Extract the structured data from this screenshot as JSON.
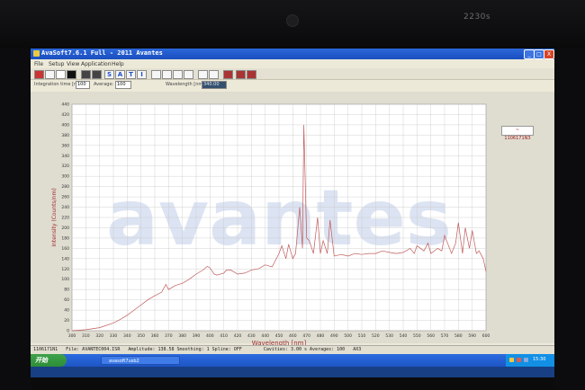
{
  "monitor": {
    "brand": "2230s"
  },
  "window": {
    "title": "AvaSoft7.6.1 Full - 2011 Avantes",
    "min_label": "_",
    "max_label": "□",
    "close_label": "X"
  },
  "menu": [
    "File",
    "Setup",
    "View",
    "Application",
    "Help"
  ],
  "toolbar": {
    "tool_s": "S",
    "tool_a": "A",
    "tool_t": "T",
    "tool_i": "I"
  },
  "params": {
    "integration_label": "Integration time [ms]:",
    "integration_value": "100",
    "average_label": "Average:",
    "average_value": "100",
    "wavelength_label": "Wavelength [nm]:",
    "wavelength_value": "340.00"
  },
  "legend": {
    "label": "~ 1106171N3"
  },
  "status": {
    "text": "1106171N1   File: AVANTEC004.ISR   Amplitude: 138.58 Smoothing: 1 Spline: OFF        Cavities: 3.00 s Averages: 100   AX3"
  },
  "taskbar": {
    "start_label": "开始",
    "task_label": "avasoft7usb2",
    "clock": "15:30"
  },
  "chart_data": {
    "type": "line",
    "title": "",
    "xlabel": "Wavelength [nm]",
    "ylabel": "Intensity (Counts/nm)",
    "xlim": [
      300,
      600
    ],
    "ylim": [
      0,
      440
    ],
    "x_ticks": [
      300,
      310,
      320,
      330,
      340,
      350,
      360,
      370,
      380,
      390,
      400,
      410,
      420,
      430,
      440,
      450,
      460,
      470,
      480,
      490,
      500,
      510,
      520,
      530,
      540,
      550,
      560,
      570,
      580,
      590,
      600
    ],
    "y_ticks": [
      0,
      20,
      40,
      60,
      80,
      100,
      120,
      140,
      160,
      180,
      200,
      220,
      240,
      260,
      280,
      300,
      320,
      340,
      360,
      380,
      400,
      420,
      440
    ],
    "grid": true,
    "line_color": "#c05a5a",
    "watermark": "avantes",
    "annotations": [],
    "series": [
      {
        "x": [
          300,
          310,
          320,
          330,
          335,
          340,
          345,
          350,
          355,
          360,
          365,
          368,
          370,
          375,
          380,
          385,
          390,
          395,
          398,
          400,
          403,
          405,
          410,
          412,
          415,
          420,
          425,
          428,
          430,
          435,
          440,
          445,
          450,
          452,
          455,
          457,
          460,
          462,
          465,
          467,
          468,
          470,
          472,
          475,
          478,
          480,
          482,
          485,
          487,
          490,
          495,
          500,
          505,
          510,
          515,
          520,
          525,
          530,
          535,
          540,
          545,
          548,
          550,
          555,
          558,
          560,
          565,
          568,
          570,
          575,
          578,
          580,
          583,
          585,
          588,
          590,
          593,
          595,
          598,
          600
        ],
        "values": [
          0,
          2,
          6,
          15,
          22,
          30,
          40,
          50,
          60,
          68,
          75,
          90,
          80,
          88,
          92,
          100,
          110,
          118,
          125,
          122,
          110,
          108,
          112,
          118,
          118,
          110,
          112,
          115,
          118,
          120,
          128,
          124,
          150,
          165,
          140,
          168,
          140,
          150,
          240,
          160,
          400,
          180,
          175,
          150,
          220,
          150,
          175,
          150,
          215,
          145,
          148,
          145,
          150,
          148,
          150,
          150,
          155,
          152,
          150,
          152,
          160,
          150,
          165,
          155,
          170,
          150,
          160,
          155,
          185,
          150,
          170,
          210,
          150,
          200,
          160,
          195,
          150,
          155,
          140,
          115
        ]
      }
    ]
  }
}
